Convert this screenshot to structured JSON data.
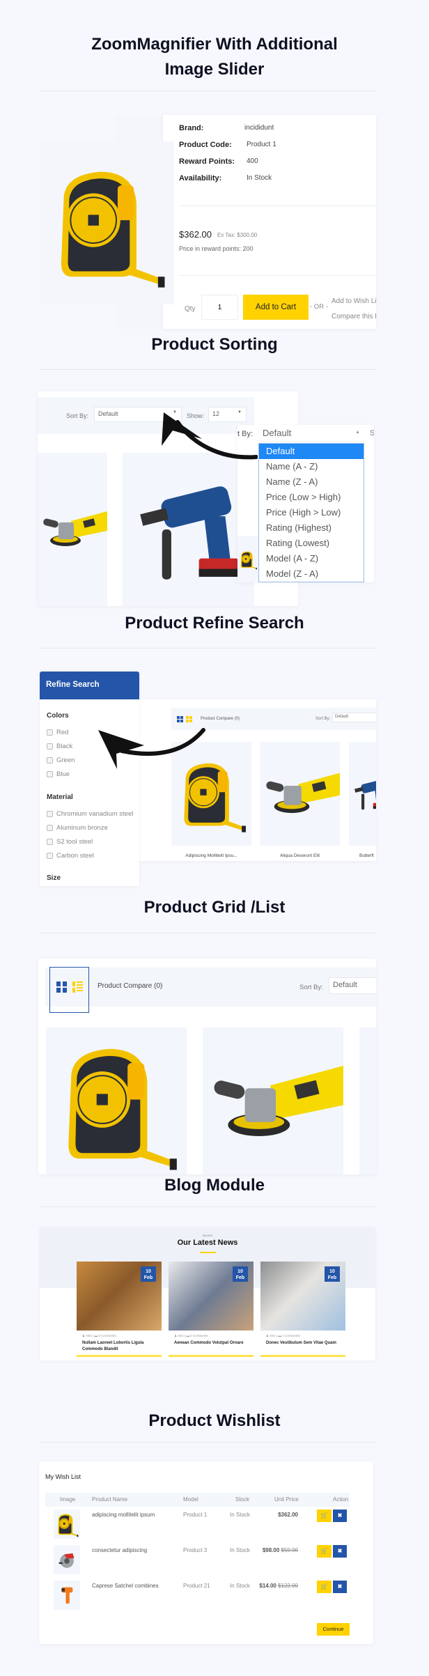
{
  "sections": {
    "zoom": {
      "title_line1": "ZoomMagnifier With Additional",
      "title_line2": "Image Slider"
    },
    "sorting": {
      "title": "Product Sorting"
    },
    "refine": {
      "title": "Product Refine Search"
    },
    "grid": {
      "title": "Product Grid /List"
    },
    "blog": {
      "title": "Blog Module"
    },
    "wishlist": {
      "title": "Product Wishlist"
    }
  },
  "product": {
    "brand_label": "Brand:",
    "brand": "incididunt",
    "code_label": "Product Code:",
    "code": "Product 1",
    "reward_label": "Reward Points:",
    "reward": "400",
    "availability_label": "Availability:",
    "availability": "In Stock",
    "price": "$362.00",
    "ex_tax": "Ex Tax: $300.00",
    "reward_price": "Price in reward points: 200",
    "qty_label": "Qty",
    "qty": "1",
    "add_to_cart": "Add to Cart",
    "or": "- OR -",
    "add_to_wish": "Add to Wish List",
    "compare": "Compare this Product"
  },
  "sorting": {
    "sort_label": "Sort By:",
    "sort_value": "Default",
    "show_label": "Show:",
    "show_value": "12",
    "overlay_label": "t By:",
    "overlay_value": "Default",
    "overlay_next": "S",
    "options": [
      "Default",
      "Name (A - Z)",
      "Name (Z - A)",
      "Price (Low > High)",
      "Price (High > Low)",
      "Rating (Highest)",
      "Rating (Lowest)",
      "Model (A - Z)",
      "Model (Z - A)"
    ],
    "selected_index": 0
  },
  "refine": {
    "header": "Refine Search",
    "groups": [
      {
        "title": "Colors",
        "items": [
          "Red",
          "Black",
          "Green",
          "Blue"
        ]
      },
      {
        "title": "Material",
        "items": [
          "Chromium vanadium steel",
          "Aluminum bronze",
          "S2 tool steel",
          "Carbon steel"
        ]
      },
      {
        "title": "Size",
        "items": []
      }
    ],
    "compare": "Product Compare (0)",
    "sort_label": "Sort By:",
    "sort_value": "Default",
    "products": [
      "Adipiscing Mollitelit Ipsu...",
      "Aliqua Deserunt Elit",
      "Butterfl"
    ]
  },
  "grid": {
    "compare": "Product Compare (0)",
    "sort_label": "Sort By:",
    "sort_value": "Default",
    "active_view": "grid"
  },
  "blog": {
    "kicker": "BLOGS",
    "heading": "Our Latest News",
    "posts": [
      {
        "day": "10",
        "month": "Feb",
        "author": "Alex",
        "comments": "0 Comments",
        "title": "Nullam Laoreet Lobortis Ligula Commodo Blandit"
      },
      {
        "day": "10",
        "month": "Feb",
        "author": "Alex",
        "comments": "0 Comments",
        "title": "Aenean Commodo Volutpat Ornare"
      },
      {
        "day": "10",
        "month": "Feb",
        "author": "Alex",
        "comments": "1 Comments",
        "title": "Donec Vestibulum Sem Vitae Quam"
      }
    ]
  },
  "wishlist": {
    "heading": "My Wish List",
    "columns": [
      "Image",
      "Product Name",
      "Model",
      "Stock",
      "Unit Price",
      "Action"
    ],
    "rows": [
      {
        "name": "adipiscing mollitelit ipsum",
        "model": "Product 1",
        "stock": "In Stock",
        "price": "$362.00",
        "old_price": ""
      },
      {
        "name": "consectetur adipiscing",
        "model": "Product 3",
        "stock": "In Stock",
        "price": "$98.00",
        "old_price": "$50.00"
      },
      {
        "name": "Caprese Satchel combines",
        "model": "Product 21",
        "stock": "In Stock",
        "price": "$14.00",
        "old_price": "$122.00"
      }
    ],
    "continue": "Continue"
  },
  "colors": {
    "accent_yellow": "#ffd200",
    "accent_blue": "#2455a8",
    "highlight": "#1e88f5",
    "background": "#f7f8fd"
  }
}
